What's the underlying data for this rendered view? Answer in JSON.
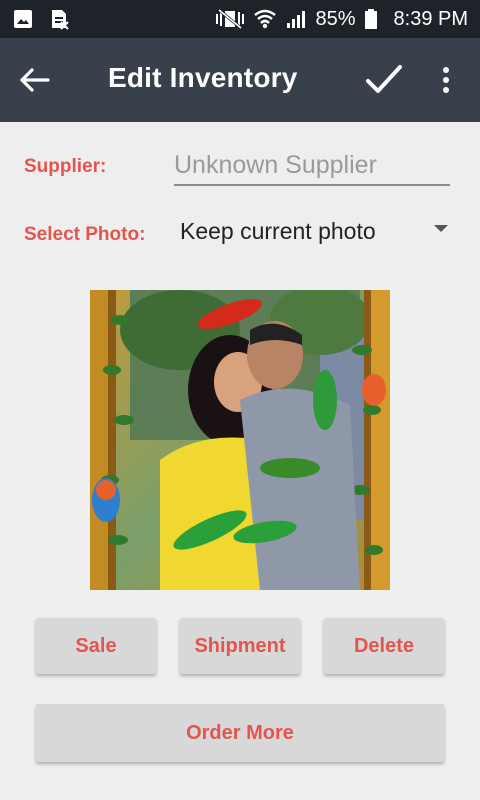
{
  "status_bar": {
    "battery": "85%",
    "time": "8:39 PM",
    "icons": [
      "gallery-icon",
      "sim-card-icon",
      "vibrate-mute-icon",
      "wifi-icon",
      "cell-signal-icon",
      "battery-icon"
    ]
  },
  "app_bar": {
    "title": "Edit Inventory",
    "icons": [
      "back-arrow-icon",
      "checkmark-icon",
      "more-vert-icon"
    ]
  },
  "form": {
    "supplier_label": "Supplier:",
    "supplier_value": "",
    "supplier_placeholder": "Unknown Supplier",
    "photo_label": "Select Photo:",
    "photo_selected": "Keep current photo"
  },
  "buttons": {
    "sale": "Sale",
    "shipment": "Shipment",
    "delete": "Delete",
    "order_more": "Order More"
  },
  "colors": {
    "status_bar": "#1e232a",
    "app_bar": "#38404b",
    "accent": "#e3564f",
    "background": "#eeeeee",
    "button": "#d8d8d8"
  }
}
